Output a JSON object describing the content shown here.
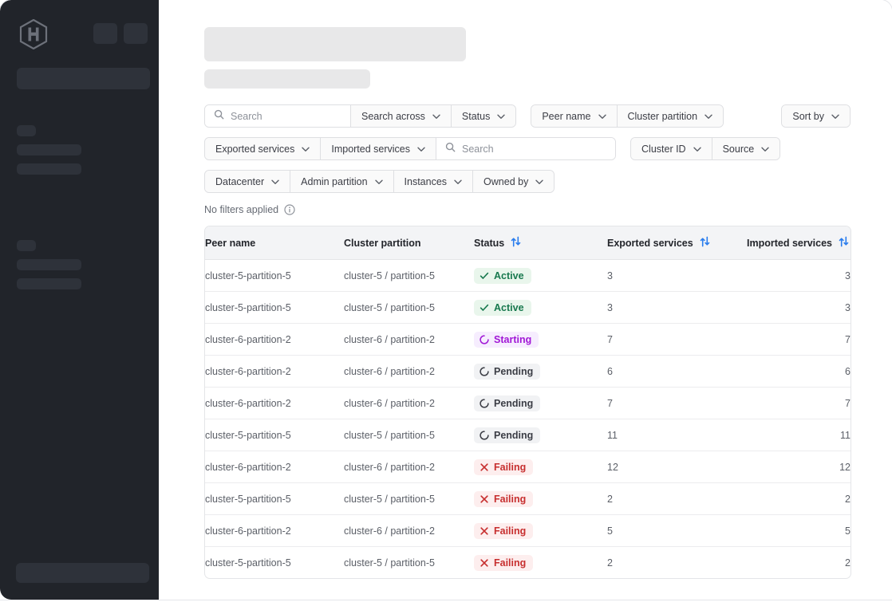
{
  "sidebar": {
    "logo_icon": "hashicorp-logo-icon",
    "skeleton_items": [
      {
        "name": "sidebar-skeleton-chip-1"
      },
      {
        "name": "sidebar-skeleton-chip-2"
      },
      {
        "name": "sidebar-skeleton-search"
      },
      {
        "name": "sidebar-skeleton-section-label-a"
      },
      {
        "name": "sidebar-skeleton-row-a1"
      },
      {
        "name": "sidebar-skeleton-row-a2"
      },
      {
        "name": "sidebar-skeleton-section-label-b"
      },
      {
        "name": "sidebar-skeleton-row-b1"
      },
      {
        "name": "sidebar-skeleton-row-b2"
      },
      {
        "name": "sidebar-skeleton-footer"
      }
    ]
  },
  "header": {
    "title_placeholder": "",
    "subtitle_placeholder": ""
  },
  "toolbar": {
    "row1": {
      "search_placeholder": "Search",
      "search_value": "",
      "search_across_label": "Search across",
      "status_label": "Status",
      "peer_name_label": "Peer name",
      "cluster_partition_label": "Cluster partition",
      "sort_by_label": "Sort by"
    },
    "row2": {
      "exported_services_label": "Exported services",
      "imported_services_label": "Imported services",
      "search_placeholder": "Search",
      "search_value": "",
      "cluster_id_label": "Cluster ID",
      "source_label": "Source"
    },
    "row3": {
      "datacenter_label": "Datacenter",
      "admin_partition_label": "Admin partition",
      "instances_label": "Instances",
      "owned_by_label": "Owned by"
    }
  },
  "filters_note": {
    "text": "No filters applied",
    "info_icon": "info-circle-icon"
  },
  "table": {
    "columns": [
      {
        "key": "peer_name",
        "label": "Peer name",
        "sortable": false
      },
      {
        "key": "cluster_partition",
        "label": "Cluster partition",
        "sortable": false
      },
      {
        "key": "status",
        "label": "Status",
        "sortable": true
      },
      {
        "key": "exported_services",
        "label": "Exported services",
        "sortable": true
      },
      {
        "key": "imported_services",
        "label": "Imported services",
        "sortable": true
      }
    ],
    "rows": [
      {
        "peer_name": "cluster-5-partition-5",
        "cluster_partition": "cluster-5 / partition-5",
        "status": "Active",
        "status_kind": "active",
        "exported_services": "3",
        "imported_services": "3"
      },
      {
        "peer_name": "cluster-5-partition-5",
        "cluster_partition": "cluster-5 / partition-5",
        "status": "Active",
        "status_kind": "active",
        "exported_services": "3",
        "imported_services": "3"
      },
      {
        "peer_name": "cluster-6-partition-2",
        "cluster_partition": "cluster-6 / partition-2",
        "status": "Starting",
        "status_kind": "starting",
        "exported_services": "7",
        "imported_services": "7"
      },
      {
        "peer_name": "cluster-6-partition-2",
        "cluster_partition": "cluster-6 / partition-2",
        "status": "Pending",
        "status_kind": "pending",
        "exported_services": "6",
        "imported_services": "6"
      },
      {
        "peer_name": "cluster-6-partition-2",
        "cluster_partition": "cluster-6 / partition-2",
        "status": "Pending",
        "status_kind": "pending",
        "exported_services": "7",
        "imported_services": "7"
      },
      {
        "peer_name": "cluster-5-partition-5",
        "cluster_partition": "cluster-5 / partition-5",
        "status": "Pending",
        "status_kind": "pending",
        "exported_services": "11",
        "imported_services": "11"
      },
      {
        "peer_name": "cluster-6-partition-2",
        "cluster_partition": "cluster-6 / partition-2",
        "status": "Failing",
        "status_kind": "failing",
        "exported_services": "12",
        "imported_services": "12"
      },
      {
        "peer_name": "cluster-5-partition-5",
        "cluster_partition": "cluster-5 / partition-5",
        "status": "Failing",
        "status_kind": "failing",
        "exported_services": "2",
        "imported_services": "2"
      },
      {
        "peer_name": "cluster-6-partition-2",
        "cluster_partition": "cluster-6 / partition-2",
        "status": "Failing",
        "status_kind": "failing",
        "exported_services": "5",
        "imported_services": "5"
      },
      {
        "peer_name": "cluster-5-partition-5",
        "cluster_partition": "cluster-5 / partition-5",
        "status": "Failing",
        "status_kind": "failing",
        "exported_services": "2",
        "imported_services": "2"
      }
    ]
  },
  "colors": {
    "sidebar_bg": "#21242a",
    "skeleton_dark": "#2e323a",
    "skeleton_light": "#e8e8e9",
    "sort_icon": "#2a7ded",
    "status_active": "#18794e",
    "status_active_bg": "#e9f6ec",
    "status_starting": "#a117d6",
    "status_starting_bg": "#f6edfe",
    "status_pending": "#3b3d45",
    "status_pending_bg": "#f1f2f4",
    "status_failing": "#c72f2f",
    "status_failing_bg": "#fdeeee"
  }
}
